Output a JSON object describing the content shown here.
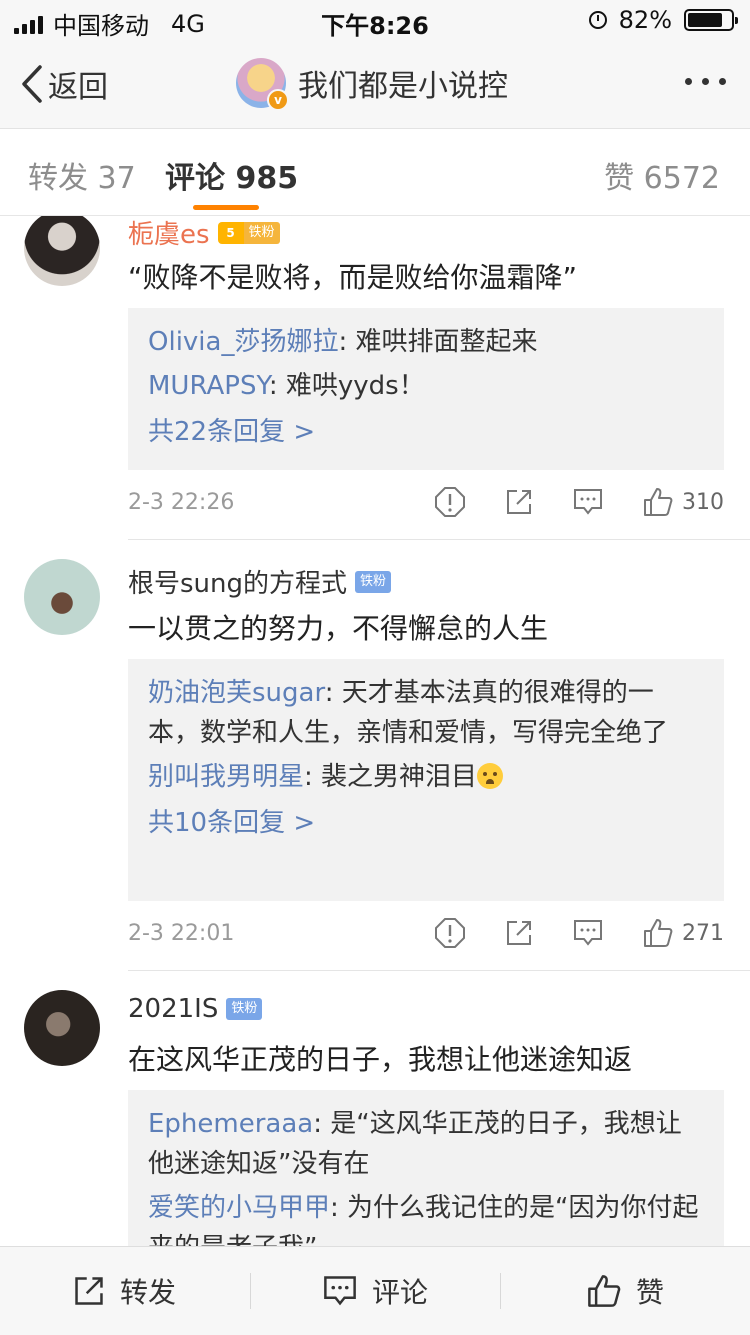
{
  "status_bar": {
    "carrier": "中国移动",
    "network": "4G",
    "time": "下午8:26",
    "battery_percent": "82%",
    "battery_level": 0.82
  },
  "nav": {
    "back_label": "返回",
    "title": "我们都是小说控",
    "verified_badge": "v",
    "more_icon": "more-dots-icon"
  },
  "tabs": [
    {
      "label": "转发 37"
    },
    {
      "label": "评论 985"
    },
    {
      "label": "赞 6572"
    }
  ],
  "comments": [
    {
      "username": "栀虞es",
      "fan_level": "5",
      "fan_badge": "铁粉",
      "text": "“败降不是败将，而是败给你温霜降”",
      "replies": [
        {
          "name": "Olivia_莎扬娜拉",
          "sep": ": ",
          "text": "难哄排面整起来"
        },
        {
          "name": "MURAPSY",
          "sep": ": ",
          "text": "难哄yyds！"
        }
      ],
      "more_replies": "共22条回复 >",
      "time": "2-3 22:26",
      "likes": "310"
    },
    {
      "username": "根号sung的方程式",
      "fan_badge": "铁粉",
      "text": "一以贯之的努力，不得懈怠的人生",
      "replies": [
        {
          "name": "奶油泡芙sugar",
          "sep": ": ",
          "text": "天才基本法真的很难得的一本，数学和人生，亲情和爱情，写得完全绝了"
        },
        {
          "name": "别叫我男明星",
          "sep": ": ",
          "text": "裴之男神泪目"
        }
      ],
      "more_replies": "共10条回复 >",
      "time": "2-3 22:01",
      "likes": "271"
    },
    {
      "username": "2021IS",
      "fan_badge": "铁粉",
      "text": "在这风华正茂的日子，我想让他迷途知返",
      "replies": [
        {
          "name": "Ephemeraaa",
          "sep": ": ",
          "text": "是“这风华正茂的日子，我想让他迷途知返”没有在"
        },
        {
          "name": "爱笑的小马甲甲",
          "sep": ": ",
          "text": "为什么我记住的是“因为你付起来的是老子我”"
        }
      ]
    }
  ],
  "bottom_bar": {
    "repost_label": "转发",
    "comment_label": "评论",
    "like_label": "赞"
  },
  "colors": {
    "accent": "#ff8200",
    "link": "#5d7fb8",
    "orange_name": "#eb7350"
  }
}
